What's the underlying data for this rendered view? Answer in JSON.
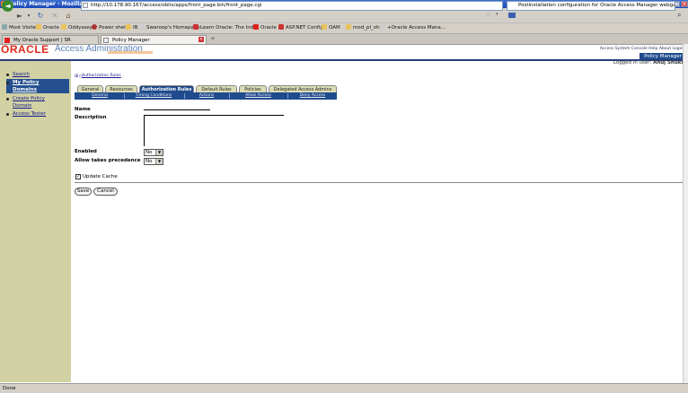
{
  "window": {
    "title": "Policy Manager - Mozilla Firefox"
  },
  "browser": {
    "url": "http://10.178.90.167/access/oblix/apps/front_page.bin/front_page.cgi",
    "search_text": "Postinstallation configuration for Oracle Access Manager webgate",
    "bookmarks": [
      "Most Visited",
      "Oracle",
      "Oddyssey",
      "Power shell",
      "IB",
      "Swaroop's Homepage",
      "Learn Oracle: The Ind...",
      "Oracle",
      "ASP.NET Config",
      "OAM",
      "mod_pl_ohs",
      "+Oracle Access Mana..."
    ],
    "tabs": [
      "My Oracle Support | SR",
      "Policy Manager"
    ],
    "status": "Done"
  },
  "header": {
    "logo": "ORACLE",
    "app_title": "Access Administration",
    "top_links": "Access System Console  Help  About  Logout",
    "pm_button": "Policy Manager",
    "logged_in_label": "Logged in user:",
    "logged_in_user": "Anuj Shukla"
  },
  "sidenav": {
    "items": [
      "Search",
      "My Policy",
      "Domains",
      "Create Policy",
      "Domain",
      "Access Tester"
    ]
  },
  "breadcrumb": "Authorization Rules",
  "tabs": [
    "General",
    "Resources",
    "Authorization Rules",
    "Default Rules",
    "Policies",
    "Delegated Access Admins"
  ],
  "subtabs": [
    "General",
    "Timing Conditions",
    "Actions",
    "Allow Access",
    "Deny Access"
  ],
  "form": {
    "name_label": "Name",
    "description_label": "Description",
    "enabled_label": "Enabled",
    "enabled_value": "No",
    "precedence_label": "Allow takes precedence",
    "precedence_value": "No",
    "update_cache_label": "Update Cache",
    "update_cache_checked": true,
    "save_label": "Save",
    "cancel_label": "Cancel"
  }
}
